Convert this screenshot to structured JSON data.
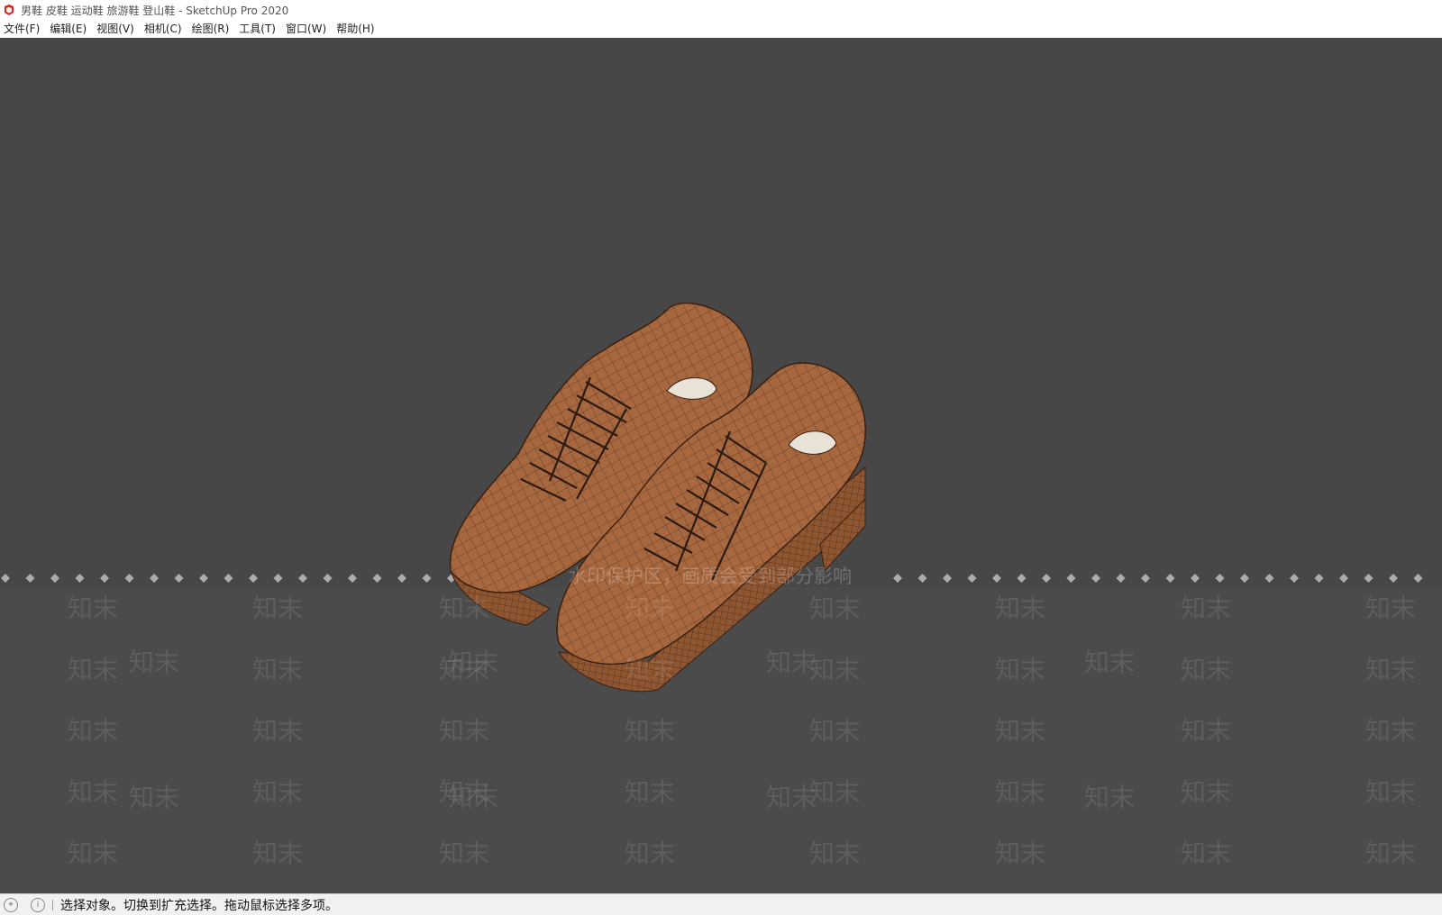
{
  "window": {
    "title": "男鞋 皮鞋 运动鞋 旅游鞋 登山鞋 - SketchUp Pro 2020",
    "app_icon": "sketchup-logo-icon",
    "accent_color": "#e1251b"
  },
  "menubar": {
    "items": [
      {
        "label": "文件(F)"
      },
      {
        "label": "编辑(E)"
      },
      {
        "label": "视图(V)"
      },
      {
        "label": "相机(C)"
      },
      {
        "label": "绘图(R)"
      },
      {
        "label": "工具(T)"
      },
      {
        "label": "窗口(W)"
      },
      {
        "label": "帮助(H)"
      }
    ]
  },
  "viewport": {
    "background_color": "#474747",
    "model": "pair-of-brown-shoes-wireframe",
    "model_color": "#a8683f",
    "watermark": {
      "brand": "知末",
      "notice": "水印保护区，画质会受到部分影响"
    }
  },
  "statusbar": {
    "icons": [
      "geolocation-icon",
      "info-icon"
    ],
    "message": "选择对象。切换到扩充选择。拖动鼠标选择多项。"
  }
}
